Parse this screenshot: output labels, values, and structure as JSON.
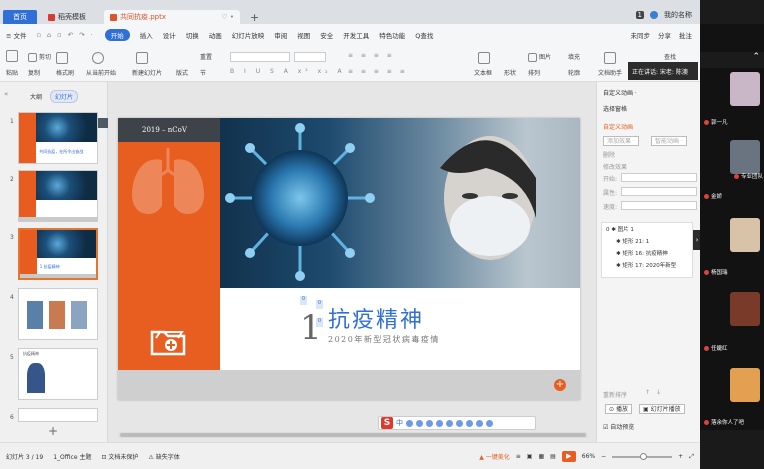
{
  "titlebar": {
    "home_tab": "首页",
    "doc1_tab": "稻壳模板",
    "doc2_tab": "共同抗疫.pptx",
    "add_tab": "+",
    "page_count": "1",
    "user": "我的名称"
  },
  "menu": {
    "file": "≡ 文件",
    "items": [
      "开始",
      "插入",
      "设计",
      "切换",
      "动画",
      "幻灯片放映",
      "审阅",
      "视图",
      "安全",
      "开发工具",
      "特色功能",
      "Q查找"
    ],
    "active_index": 0,
    "right": [
      "未同步",
      "分享",
      "批注"
    ]
  },
  "ribbon": {
    "paste": "粘贴",
    "cut": "剪切",
    "copy": "复制",
    "format_painter": "格式刷",
    "from_current": "从当前开始",
    "new_slide": "新建幻灯片",
    "layout": "版式",
    "section": "节",
    "reset": "重置",
    "textbox": "文本框",
    "shape": "形状",
    "arrange": "排列",
    "picture": "图片",
    "fill": "填充",
    "outline": "轮廓",
    "find": "查找",
    "doc_assistant": "文档助手"
  },
  "notice": "正在讲话: 宋老: 陈澳",
  "left_panel": {
    "tabs": [
      "大纲",
      "幻灯片"
    ],
    "thumbs": [
      {
        "num": "1",
        "text": "共同抗疫，在所令出奋战"
      },
      {
        "num": "2",
        "text": ""
      },
      {
        "num": "3",
        "text": "1 抗疫精神"
      },
      {
        "num": "4",
        "text": ""
      },
      {
        "num": "5",
        "text": "抗疫精神"
      },
      {
        "num": "6",
        "text": ""
      }
    ],
    "add": "+"
  },
  "slide": {
    "header": "2019 – nCoV",
    "number": "1",
    "title": "抗疫精神",
    "subtitle": "2020年新型冠状病毒疫情",
    "marker": "0"
  },
  "ime": {
    "logo": "S",
    "label": "中"
  },
  "taskpane": {
    "custom_anim": "自定义动画 ·",
    "select_pane": "选择窗格",
    "custom_anim_title": "自定义动画",
    "add_effect": "添加效果 ·",
    "smart_anim": "智能动画 ·",
    "delete": "删除",
    "modify": "修改效果",
    "start": "开始:",
    "property": "属性:",
    "speed": "速度:",
    "list": [
      {
        "n": "0",
        "label": "图片 1"
      },
      {
        "n": "",
        "label": "矩形 21: 1"
      },
      {
        "n": "",
        "label": "矩形 16: 抗疫精神"
      },
      {
        "n": "",
        "label": "矩形 17: 2020年新型"
      }
    ],
    "reorder": "重新排序",
    "play": "播放",
    "slideshow": "幻灯片播放",
    "autopreview": "自动预览"
  },
  "video": {
    "participants": [
      "",
      "郭一凡",
      "专业团队",
      "金娇",
      "",
      "杨国瑞",
      "",
      "任婕红",
      "",
      "落余你人了吧"
    ]
  },
  "status": {
    "slide": "幻灯片 3 / 19",
    "theme": "1_Office 主题",
    "protect": "文档未保护",
    "font": "缺失字体",
    "beautify": "一键美化",
    "zoom": "66%"
  }
}
